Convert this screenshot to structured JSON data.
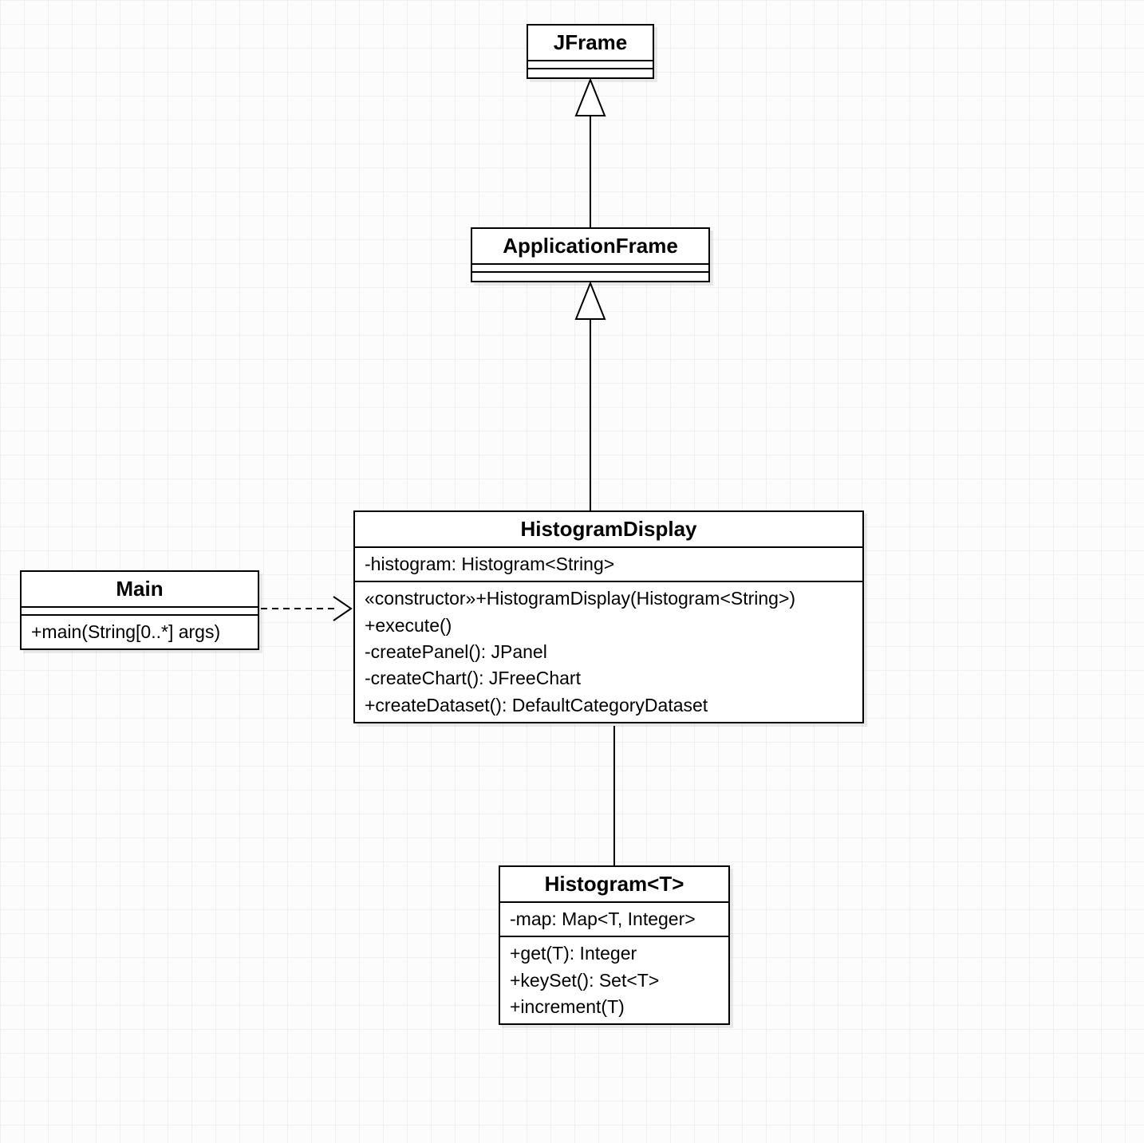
{
  "classes": {
    "jframe": {
      "name": "JFrame",
      "attributes": [],
      "methods": []
    },
    "applicationFrame": {
      "name": "ApplicationFrame",
      "attributes": [],
      "methods": []
    },
    "main": {
      "name": "Main",
      "attributes": [],
      "methods": [
        "+main(String[0..*] args)"
      ]
    },
    "histogramDisplay": {
      "name": "HistogramDisplay",
      "attributes": [
        "-histogram: Histogram<String>"
      ],
      "methods": [
        "«constructor»+HistogramDisplay(Histogram<String>)",
        "+execute()",
        "-createPanel(): JPanel",
        "-createChart(): JFreeChart",
        "+createDataset(): DefaultCategoryDataset"
      ]
    },
    "histogram": {
      "name": "Histogram<T>",
      "attributes": [
        "-map: Map<T, Integer>"
      ],
      "methods": [
        "+get(T): Integer",
        "+keySet(): Set<T>",
        "+increment(T)"
      ]
    }
  },
  "relationships": [
    {
      "from": "ApplicationFrame",
      "to": "JFrame",
      "type": "inheritance"
    },
    {
      "from": "HistogramDisplay",
      "to": "ApplicationFrame",
      "type": "inheritance"
    },
    {
      "from": "Main",
      "to": "HistogramDisplay",
      "type": "dependency"
    },
    {
      "from": "HistogramDisplay",
      "to": "Histogram<T>",
      "type": "association"
    }
  ]
}
